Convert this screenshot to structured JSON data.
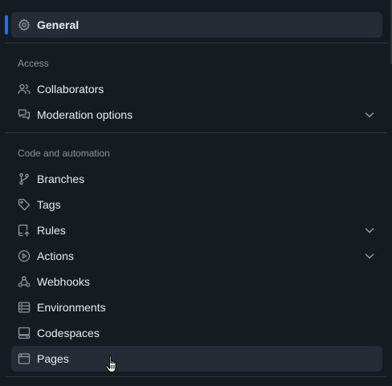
{
  "nav": {
    "general": {
      "label": "General",
      "icon": "gear-icon"
    },
    "access": {
      "heading": "Access",
      "items": [
        {
          "label": "Collaborators",
          "icon": "people-icon"
        },
        {
          "label": "Moderation options",
          "icon": "comment-discussion-icon",
          "expandable": true
        }
      ]
    },
    "code_automation": {
      "heading": "Code and automation",
      "items": [
        {
          "label": "Branches",
          "icon": "git-branch-icon"
        },
        {
          "label": "Tags",
          "icon": "tag-icon"
        },
        {
          "label": "Rules",
          "icon": "repo-push-icon",
          "expandable": true
        },
        {
          "label": "Actions",
          "icon": "play-icon",
          "expandable": true
        },
        {
          "label": "Webhooks",
          "icon": "webhook-icon"
        },
        {
          "label": "Environments",
          "icon": "server-icon"
        },
        {
          "label": "Codespaces",
          "icon": "codespaces-icon"
        },
        {
          "label": "Pages",
          "icon": "browser-icon"
        }
      ]
    }
  },
  "colors": {
    "background": "#161b22",
    "accent": "#1f6feb",
    "text": "#e6edf3",
    "muted": "#8d96a0",
    "divider": "#30363d",
    "selected_bg": "#262c36"
  }
}
